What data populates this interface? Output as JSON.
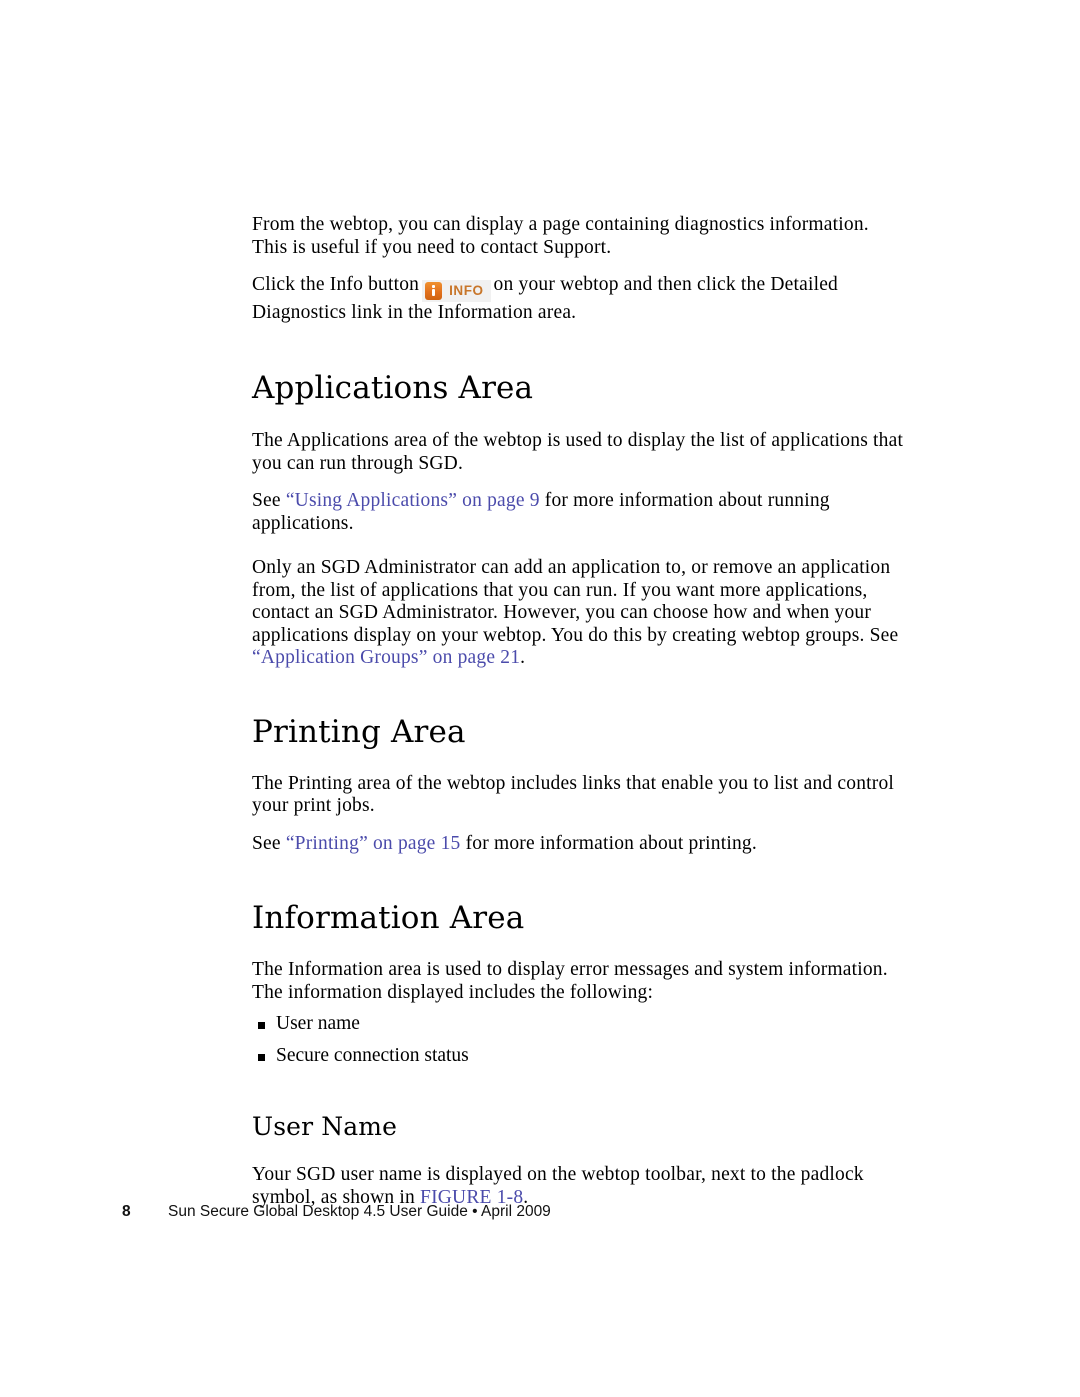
{
  "document": {
    "intro": {
      "para1": "From the webtop, you can display a page containing diagnostics information. This is useful if you need to contact Support.",
      "para2_before": "Click the Info button",
      "info_button_label": "INFO",
      "info_button_icon": "info-badge-icon",
      "para2_after": "on your webtop and then click the Detailed Diagnostics link in the Information area."
    },
    "sections": [
      {
        "heading": "Applications Area",
        "para1": "The Applications area of the webtop is used to display the list of applications that you can run through SGD.",
        "para2_before": "See ",
        "para2_link": "“Using Applications” on page 9",
        "para2_after": " for more information about running applications.",
        "para3_before": "Only an SGD Administrator can add an application to, or remove an application from, the list of applications that you can run. If you want more applications, contact an SGD Administrator. However, you can choose how and when your applications display on your webtop. You do this by creating webtop groups. See ",
        "para3_link": "“Application Groups” on page 21",
        "para3_after": "."
      },
      {
        "heading": "Printing Area",
        "para1": "The Printing area of the webtop includes links that enable you to list and control your print jobs.",
        "para2_before": "See ",
        "para2_link": "“Printing” on page 15",
        "para2_after": " for more information about printing."
      },
      {
        "heading": "Information Area",
        "para1": "The Information area is used to display error messages and system information. The information displayed includes the following:",
        "bullets": [
          "User name",
          "Secure connection status"
        ]
      }
    ],
    "subsection": {
      "heading": "User Name",
      "para_before": "Your SGD user name is displayed on the webtop toolbar, next to the padlock symbol, as shown in ",
      "para_link": "FIGURE 1-8",
      "para_after": "."
    },
    "footer": {
      "page_number": "8",
      "text": "Sun Secure Global Desktop 4.5 User Guide  •  April 2009"
    },
    "colors": {
      "link": "#4b4bab",
      "info_orange": "#e2711d",
      "info_label": "#c8762a",
      "info_bg": "#f1f1f1",
      "text": "#000000"
    }
  }
}
